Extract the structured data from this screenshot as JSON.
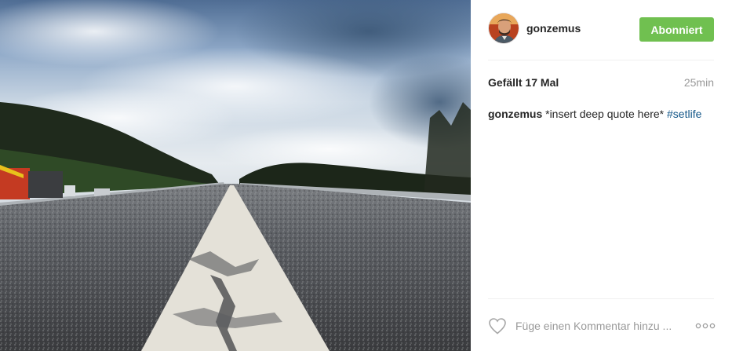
{
  "post": {
    "username": "gonzemus",
    "follow_button": "Abonniert",
    "likes": "Gefällt 17 Mal",
    "time_ago": "25min",
    "caption": {
      "username": "gonzemus",
      "text": "*insert deep quote here*",
      "hashtag": "#setlife"
    },
    "comment_placeholder": "Füge einen Kommentar hinzu ..."
  },
  "icons": {
    "like": "heart-outline-icon",
    "more": "ellipsis-icon"
  },
  "colors": {
    "follow_button_bg": "#70c050",
    "hashtag": "#125688",
    "muted_text": "#999999"
  }
}
